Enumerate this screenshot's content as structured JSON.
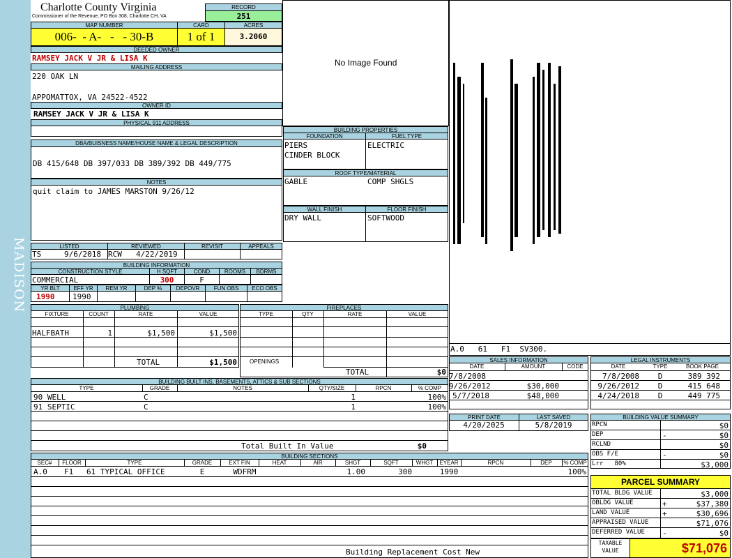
{
  "sidebar": {
    "town": "MADISON"
  },
  "header": {
    "county": "Charlotte County Virginia",
    "office": "Commissioner of the Revenue, PO Box 308, Charlotte CH, VA",
    "record_label": "RECORD",
    "record": "251"
  },
  "map": {
    "map_label": "MAP NUMBER",
    "map_number": "006-  - A-   -   - 30-B",
    "card_label": "CARD",
    "card": "1 of 1",
    "acres_label": "ACRES",
    "acres": "3.2060"
  },
  "owner": {
    "deeded_label": "DEEDED OWNER",
    "deeded": "RAMSEY JACK V JR & LISA K",
    "mailing_label": "MAILING ADDRESS",
    "mail1": "220 OAK LN",
    "mail2": "APPOMATTOX, VA 24522-4522",
    "owner_id_label": "OWNER ID",
    "owner_id": "RAMSEY JACK V JR & LISA K",
    "physical_label": "PHYSICAL 911 ADDRESS",
    "physical": ""
  },
  "legal": {
    "label": "DBA/BUISNESS NAME/HOUSE NAME & LEGAL DESCRIPTION",
    "text": "DB 415/648 DB 397/033 DB 389/392 DB 449/775"
  },
  "notes": {
    "label": "NOTES",
    "text": "quit claim to JAMES MARSTON 9/26/12"
  },
  "review": {
    "listed_label": "LISTED",
    "reviewed_label": "REVIEWED",
    "revisit_label": "REVISIT",
    "appeals_label": "APPEALS",
    "listed_by": "TS",
    "listed_date": "9/6/2018",
    "reviewed_by": "RCW",
    "reviewed_date": "4/22/2019"
  },
  "building_info": {
    "label": "BUILDING INFORMATION",
    "style_label": "CONSTRUCTION STYLE",
    "hsqft_label": "H SQFT",
    "cond_label": "COND",
    "rooms_label": "ROOMS",
    "bdrms_label": "BDRMS",
    "style": "COMMERCIAL",
    "hsqft": "300",
    "cond": "F",
    "yrblt_label": "YR BLT",
    "effyr_label": "EFF YR",
    "remyr_label": "REM YR",
    "dep_label": "DEP %",
    "depovr_label": "DEPOVR",
    "funobs_label": "FUN OBS",
    "ecoobs_label": "ECO OBS",
    "yrblt": "1990",
    "effyr": "1990"
  },
  "image": {
    "no_image": "No Image Found"
  },
  "building_props": {
    "label": "BUILDING PROPERTIES",
    "foundation_label": "FOUNDATION",
    "fuel_label": "FUEL TYPE",
    "foundation1": "PIERS",
    "foundation2": "CINDER BLOCK",
    "fuel": "ELECTRIC",
    "roof_label": "ROOF TYPE/MATERIAL",
    "roof_type": "GABLE",
    "roof_material": "COMP SHGLS",
    "wall_label": "WALL FINISH",
    "floor_label": "FLOOR FINISH",
    "wall": "DRY WALL",
    "floor": "SOFTWOOD"
  },
  "sketch": {
    "caption": "A.0   61   F1  SV300."
  },
  "plumbing": {
    "label": "PLUMBING",
    "headers": [
      "FIXTURE",
      "COUNT",
      "RATE",
      "VALUE"
    ],
    "fixture": "HALFBATH",
    "count": "1",
    "rate": "$1,500",
    "value": "$1,500",
    "total_label": "TOTAL",
    "total": "$1,500"
  },
  "fireplaces": {
    "label": "FIREPLACES",
    "headers": [
      "TYPE",
      "QTY",
      "RATE",
      "VALUE"
    ],
    "openings_label": "OPENINGS",
    "total_label": "TOTAL",
    "total": "$0"
  },
  "sales": {
    "label": "SALES INFORMATION",
    "headers": [
      "DATE",
      "AMOUNT",
      "CODE"
    ],
    "rows": [
      [
        "7/8/2008",
        "",
        ""
      ],
      [
        "9/26/2012",
        "$30,000",
        ""
      ],
      [
        "5/7/2018",
        "$48,000",
        ""
      ]
    ]
  },
  "legal_instruments": {
    "label": "LEGAL INSTRUMENTS",
    "headers": [
      "DATE",
      "TYPE",
      "BOOK:PAGE"
    ],
    "rows": [
      [
        "7/8/2008",
        "D",
        "389 392"
      ],
      [
        "9/26/2012",
        "D",
        "415 648"
      ],
      [
        "4/24/2018",
        "D",
        "449 775"
      ]
    ]
  },
  "builtins": {
    "label": "BUILDING BUILT INS, BASEMENTS, ATTICS & SUB SECTIONS",
    "headers": [
      "TYPE",
      "GRADE",
      "NOTES",
      "QTY/SIZE",
      "RPCN",
      "% COMP"
    ],
    "rows": [
      [
        "90 WELL",
        "C",
        "",
        "1",
        "",
        "100%"
      ],
      [
        "91 SEPTIC",
        "C",
        "",
        "1",
        "",
        "100%"
      ]
    ],
    "total_label": "Total Built In Value",
    "total": "$0"
  },
  "dates": {
    "print_label": "PRINT DATE",
    "saved_label": "LAST SAVED",
    "print": "4/20/2025",
    "saved": "5/8/2019"
  },
  "value_summary": {
    "label": "BUILDING VALUE SUMMARY",
    "rows": [
      [
        "RPCN",
        "",
        "$0"
      ],
      [
        "DEP",
        "-",
        "$0"
      ],
      [
        "RCLND",
        "",
        "$0"
      ],
      [
        "OBS F/E",
        "-",
        "$0"
      ],
      [
        "Lrr   80%",
        "",
        "$3,000"
      ]
    ]
  },
  "sections": {
    "label": "BUILDING SECTIONS",
    "headers": [
      "SEC#",
      "FLOOR",
      "TYPE",
      "GRADE",
      "EXT FIN",
      "HEAT",
      "AIR",
      "SHGT",
      "SQFT",
      "WHGT",
      "EYEAR",
      "RPCN",
      "DEP",
      "% COMP"
    ],
    "row": [
      "A.0",
      "F1",
      "61 TYPICAL OFFICE",
      "E",
      "WDFRM",
      "",
      "",
      "1.00",
      "300",
      "",
      "1990",
      "",
      "",
      "100%"
    ],
    "footer": "Building Replacement Cost New"
  },
  "parcel": {
    "label": "PARCEL SUMMARY",
    "rows": [
      [
        "TOTAL BLDG VALUE",
        "",
        "$3,000"
      ],
      [
        "OBLDG VALUE",
        "+",
        "$37,380"
      ],
      [
        "LAND VALUE",
        "+",
        "$30,696"
      ],
      [
        "APPRAISED VALUE",
        "",
        "$71,076"
      ],
      [
        "DEFERRED VALUE",
        "-",
        "$0"
      ]
    ],
    "taxable_label1": "TAXABLE",
    "taxable_label2": "VALUE",
    "taxable": "$71,076"
  }
}
